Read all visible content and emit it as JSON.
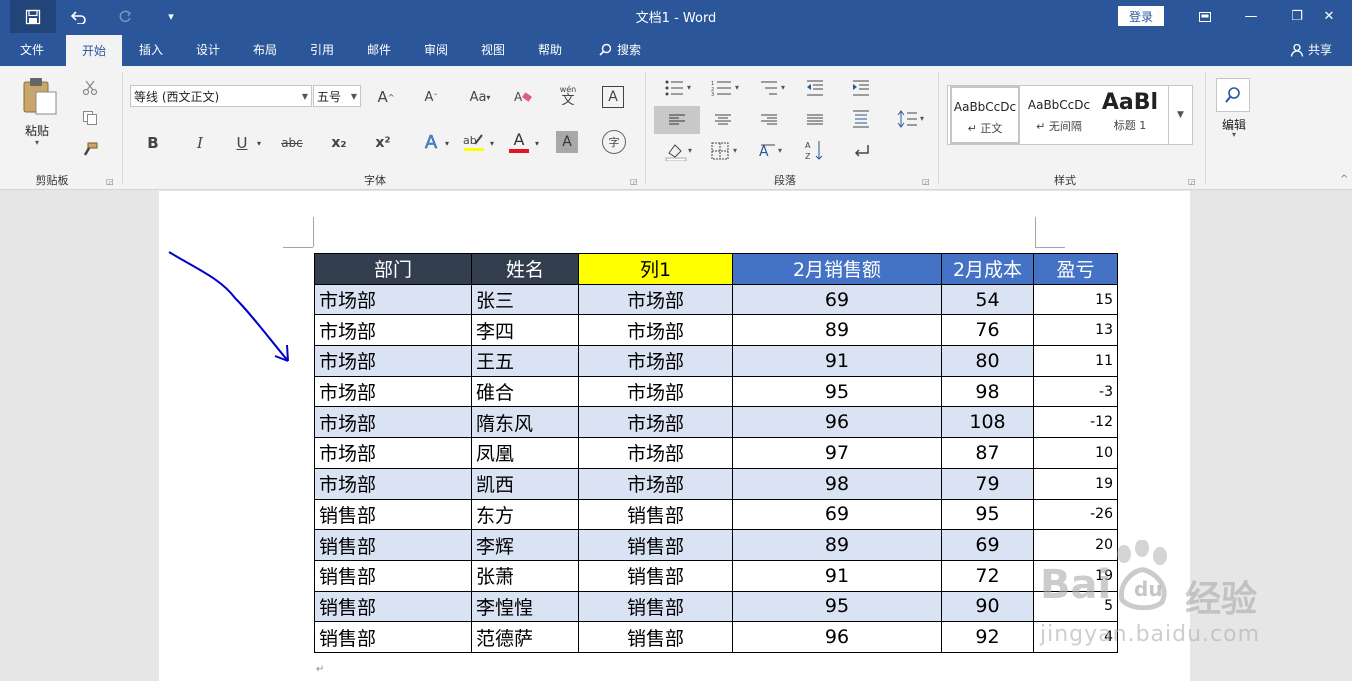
{
  "window": {
    "title": "文档1  -  Word",
    "login_label": "登录",
    "qat": {
      "save_icon": "save-icon",
      "undo_icon": "undo-icon",
      "redo_icon": "redo-icon",
      "more_icon": "customize-icon"
    },
    "controls": {
      "ribbon_display": "ribbon-display-icon",
      "minimize": "—",
      "restore": "❐",
      "close": "✕"
    }
  },
  "tabs": [
    "文件",
    "开始",
    "插入",
    "设计",
    "布局",
    "引用",
    "邮件",
    "审阅",
    "视图",
    "帮助",
    "搜索"
  ],
  "share_label": "共享",
  "ribbon": {
    "clipboard": {
      "paste_label": "粘贴",
      "group_label": "剪贴板"
    },
    "font": {
      "font_name": "等线 (西文正文)",
      "font_size": "五号",
      "group_label": "字体",
      "buttons": {
        "bold": "B",
        "italic": "I",
        "underline": "U",
        "strike": "abc",
        "subscript": "x₂",
        "superscript": "x²",
        "grow": "A",
        "shrink": "A",
        "case": "Aa",
        "phonetic": "wén",
        "phonetic_sub": "文",
        "border_char": "A",
        "font_color": "A",
        "shade": "A",
        "enclose": "字"
      }
    },
    "paragraph": {
      "group_label": "段落"
    },
    "styles": {
      "group_label": "样式",
      "items": [
        {
          "sample": "AaBbCcDc",
          "name": "↵ 正文"
        },
        {
          "sample": "AaBbCcDc",
          "name": "↵ 无间隔"
        },
        {
          "sample": "AaBl",
          "name": "标题 1"
        }
      ]
    },
    "editing": {
      "label": "编辑"
    }
  },
  "table": {
    "headers": [
      {
        "text": "部门",
        "color": "#333f4f"
      },
      {
        "text": "姓名",
        "color": "#333f4f"
      },
      {
        "text": "列1",
        "color": "#ffff00"
      },
      {
        "text": "2月销售额",
        "color": "#4472c4"
      },
      {
        "text": "2月成本",
        "color": "#4472c4"
      },
      {
        "text": "盈亏",
        "color": "#4472c4"
      }
    ],
    "rows": [
      [
        "市场部",
        "张三",
        "市场部",
        "69",
        "54",
        "15"
      ],
      [
        "市场部",
        "李四",
        "市场部",
        "89",
        "76",
        "13"
      ],
      [
        "市场部",
        "王五",
        "市场部",
        "91",
        "80",
        "11"
      ],
      [
        "市场部",
        "碓合",
        "市场部",
        "95",
        "98",
        "-3"
      ],
      [
        "市场部",
        "隋东风",
        "市场部",
        "96",
        "108",
        "-12"
      ],
      [
        "市场部",
        "凤凰",
        "市场部",
        "97",
        "87",
        "10"
      ],
      [
        "市场部",
        "凯西",
        "市场部",
        "98",
        "79",
        "19"
      ],
      [
        "销售部",
        "东方",
        "销售部",
        "69",
        "95",
        "-26"
      ],
      [
        "销售部",
        "李辉",
        "销售部",
        "89",
        "69",
        "20"
      ],
      [
        "销售部",
        "张萧",
        "销售部",
        "91",
        "72",
        "19"
      ],
      [
        "销售部",
        "李惶惶",
        "销售部",
        "95",
        "90",
        "5"
      ],
      [
        "销售部",
        "范德萨",
        "销售部",
        "96",
        "92",
        "4"
      ]
    ]
  },
  "watermark": {
    "brand": "Bai",
    "brand2": "经验",
    "url": "jingyan.baidu.com"
  },
  "colors": {
    "accent": "#2b579a",
    "band": "#dae3f3",
    "arrow": "#0000cc"
  }
}
